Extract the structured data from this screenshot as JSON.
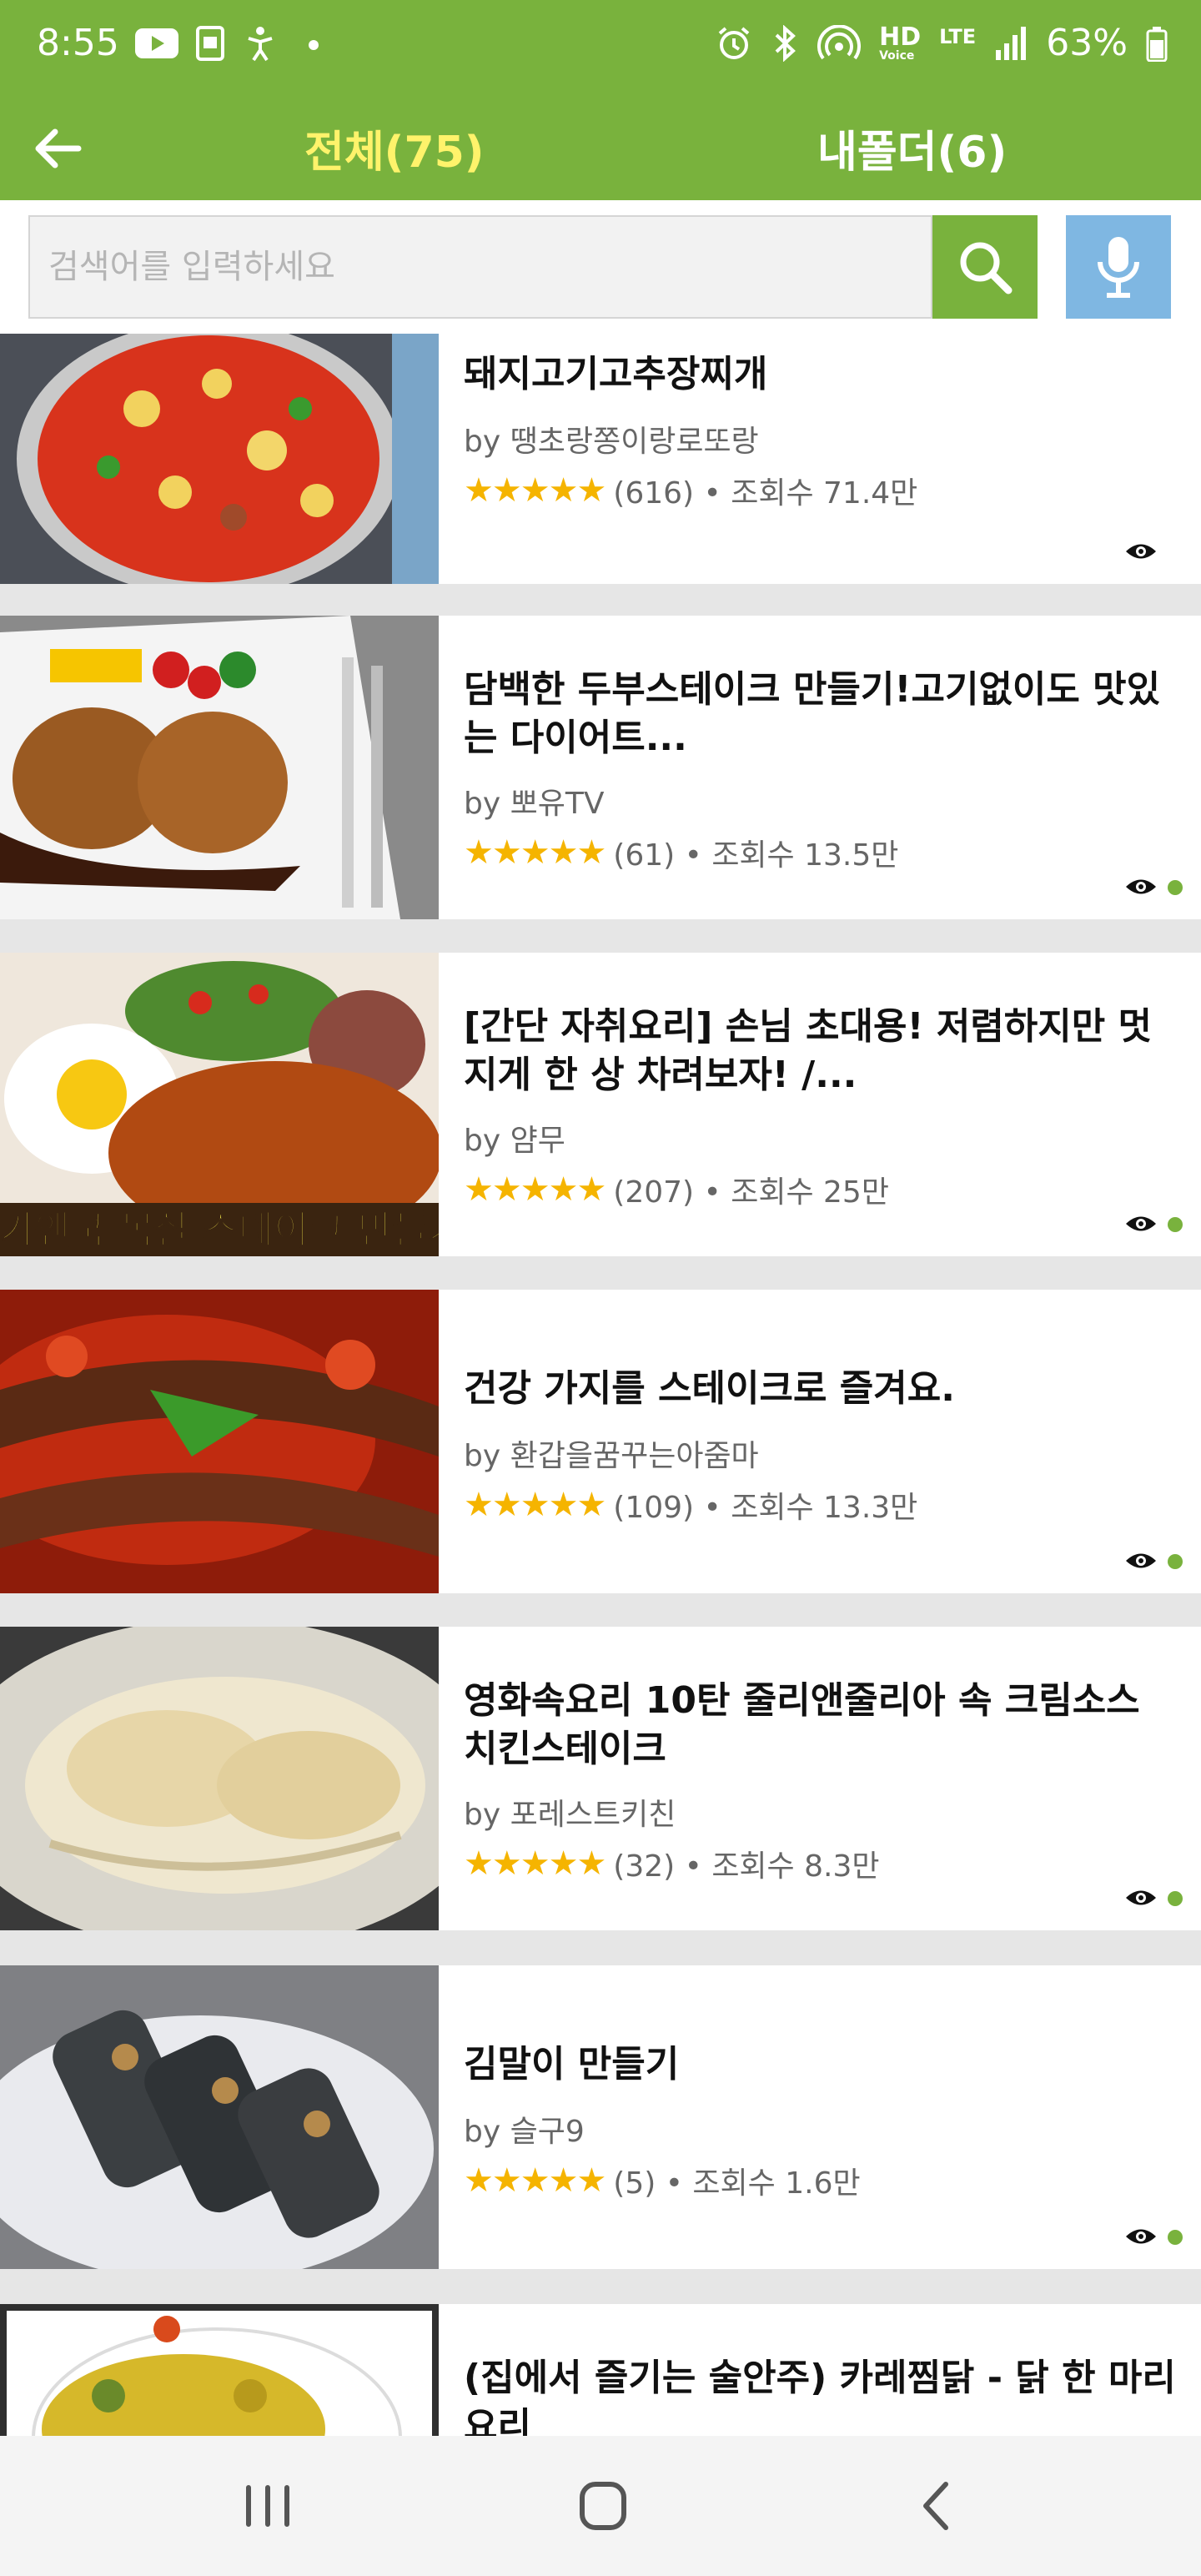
{
  "status_bar": {
    "time": "8:55",
    "battery": "63%",
    "network": "LTE",
    "hd_label": "HD",
    "voice_label": "Voice",
    "icons": [
      "youtube-icon",
      "screenshot-icon",
      "accessibility-icon",
      "dot-icon",
      "alarm-icon",
      "bluetooth-icon",
      "hotspot-icon",
      "hd-voice-icon",
      "lte-icon",
      "signal-icon",
      "battery-icon"
    ]
  },
  "header": {
    "back_icon": "back-arrow-icon",
    "tab_all": "전체(75)",
    "tab_mine": "내폴더(6)",
    "active_color": "#fff36b",
    "bg_color": "#79b23d"
  },
  "search": {
    "placeholder": "검색어를 입력하세요",
    "search_icon": "search-icon",
    "mic_icon": "microphone-icon"
  },
  "recipes": [
    {
      "title": "돼지고기고추장찌개",
      "author": "by 땡초랑쫑이랑로또랑",
      "stars": "★★★★★",
      "rating": 5,
      "stats": "(616) • 조회수 71.4만",
      "viewed": true,
      "new_dot": false
    },
    {
      "title": "담백한 두부스테이크 만들기!고기없이도 맛있는 다이어트...",
      "author": "by 뽀유TV",
      "stars": "★★★★★",
      "rating": 5,
      "stats": "(61) • 조회수 13.5만",
      "viewed": true,
      "new_dot": true
    },
    {
      "title": "[간단 자취요리] 손님 초대용! 저렴하지만 멋지게 한 상 차려보자! /...",
      "author": "by 얌무",
      "stars": "★★★★★",
      "rating": 5,
      "stats": "(207) • 조회수 25만",
      "viewed": true,
      "new_dot": true
    },
    {
      "title": "건강 가지를 스테이크로 즐겨요.",
      "author": "by 환갑을꿈꾸는아줌마",
      "stars": "★★★★★",
      "rating": 5,
      "stats": "(109) • 조회수 13.3만",
      "viewed": true,
      "new_dot": true
    },
    {
      "title": "영화속요리 10탄 줄리앤줄리아 속 크림소스 치킨스테이크",
      "author": "by 포레스트키친",
      "stars": "★★★★★",
      "rating": 5,
      "stats": "(32) • 조회수 8.3만",
      "viewed": true,
      "new_dot": true
    },
    {
      "title": "김말이 만들기",
      "author": "by 슬구9",
      "stars": "★★★★★",
      "rating": 5,
      "stats": "(5) • 조회수 1.6만",
      "viewed": true,
      "new_dot": true
    },
    {
      "title": "(집에서 즐기는 술안주) 카레찜닭 - 닭 한 마리 요리",
      "author": "",
      "stars": "",
      "rating": 0,
      "stats": "",
      "viewed": false,
      "new_dot": false
    }
  ],
  "thumbnail_caption": "가앤쿡 목살 스테이크 만들기",
  "navbar": {
    "recent_icon": "recent-apps-icon",
    "home_icon": "home-icon",
    "back_icon": "back-icon"
  }
}
